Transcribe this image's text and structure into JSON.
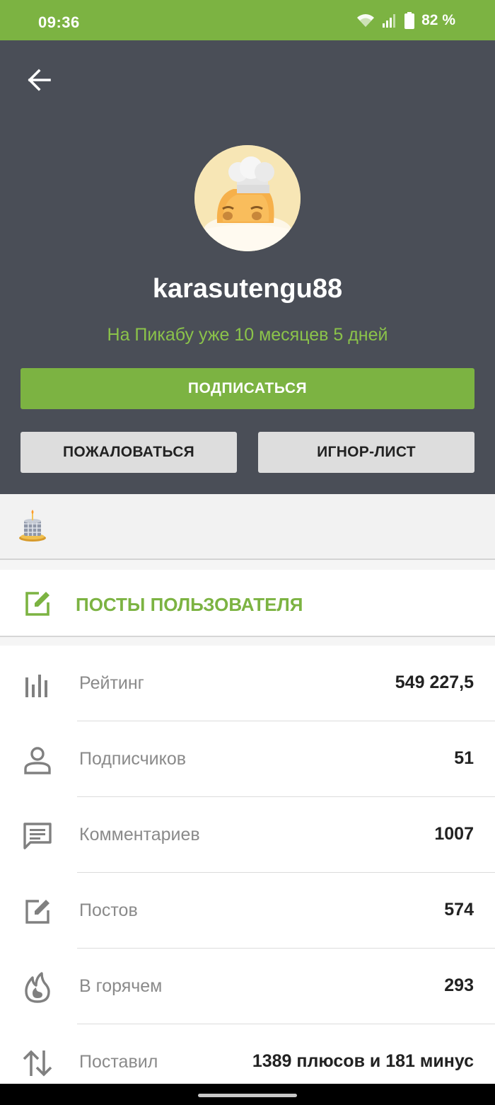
{
  "status_bar": {
    "time": "09:36",
    "battery": "82 %",
    "background_color": "#7cb342"
  },
  "header": {
    "back_icon": "arrow-left-icon",
    "username": "karasutengu88",
    "since": "На Пикабу уже 10 месяцев 5 дней",
    "subscribe_label": "ПОДПИСАТЬСЯ",
    "report_label": "ПОЖАЛОВАТЬСЯ",
    "ignore_label": "ИГНОР-ЛИСТ",
    "background_color": "#4a4e57",
    "accent_color": "#7cb342"
  },
  "awards": {
    "icon": "cake-award-icon"
  },
  "posts_link": {
    "icon": "edit-square-icon",
    "label": "ПОСТЫ ПОЛЬЗОВАТЕЛЯ"
  },
  "stats": [
    {
      "icon": "bar-chart-icon",
      "label": "Рейтинг",
      "value": "549 227,5"
    },
    {
      "icon": "person-icon",
      "label": "Подписчиков",
      "value": "51"
    },
    {
      "icon": "comment-icon",
      "label": "Комментариев",
      "value": "1007"
    },
    {
      "icon": "edit-square-icon",
      "label": "Постов",
      "value": "574"
    },
    {
      "icon": "flame-icon",
      "label": "В горячем",
      "value": "293"
    },
    {
      "icon": "sort-arrows-icon",
      "label": "Поставил",
      "value": "1389 плюсов и 181 минус"
    }
  ]
}
